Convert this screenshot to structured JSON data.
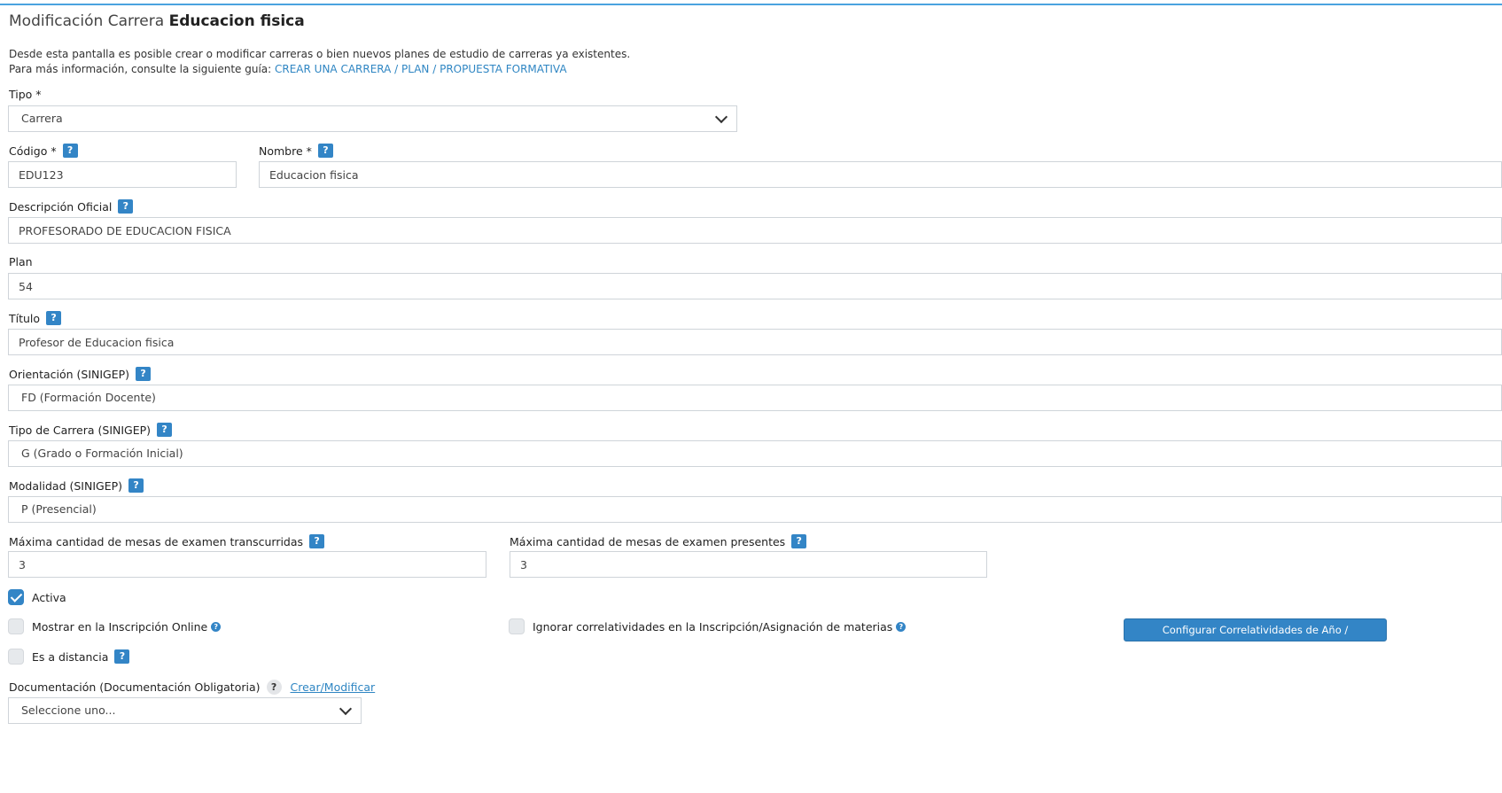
{
  "header": {
    "title_prefix": "Modificación Carrera",
    "title_name": "Educacion fisica"
  },
  "intro": {
    "line1": "Desde esta pantalla es posible crear o modificar carreras o bien nuevos planes de estudio de carreras ya existentes.",
    "line2_prefix": "Para más información, consulte la siguiente guía:",
    "guide_link": "CREAR UNA CARRERA / PLAN / PROPUESTA FORMATIVA"
  },
  "form": {
    "tipo": {
      "label": "Tipo *",
      "value": "Carrera"
    },
    "codigo": {
      "label": "Código *",
      "value": "EDU123"
    },
    "nombre": {
      "label": "Nombre *",
      "value": "Educacion fisica"
    },
    "descripcion": {
      "label": "Descripción Oficial",
      "value": "PROFESORADO DE EDUCACION FISICA"
    },
    "plan": {
      "label": "Plan",
      "value": "54"
    },
    "titulo": {
      "label": "Título",
      "value": "Profesor de Educacion fisica"
    },
    "orientacion": {
      "label": "Orientación (SINIGEP)",
      "value": "FD (Formación Docente)"
    },
    "tipo_carrera": {
      "label": "Tipo de Carrera (SINIGEP)",
      "value": "G (Grado o Formación Inicial)"
    },
    "modalidad": {
      "label": "Modalidad (SINIGEP)",
      "value": "P (Presencial)"
    },
    "max_transcurridas": {
      "label": "Máxima cantidad de mesas de examen transcurridas",
      "value": "3"
    },
    "max_presentes": {
      "label": "Máxima cantidad de mesas de examen presentes",
      "value": "3"
    },
    "activa": {
      "label": "Activa",
      "checked": true
    },
    "mostrar_online": {
      "label": "Mostrar en la Inscripción Online",
      "checked": false
    },
    "ignorar_correlatividades": {
      "label": "Ignorar correlatividades en la Inscripción/Asignación de materias",
      "checked": false
    },
    "a_distancia": {
      "label": "Es a distancia",
      "checked": false
    },
    "configurar_button": "Configurar Correlatividades de Año / Condicionalidad",
    "documentacion": {
      "label": "Documentación (Documentación Obligatoria)",
      "link": "Crear/Modificar",
      "value": "Seleccione uno..."
    }
  },
  "icons": {
    "help": "?",
    "accent": "#3385c6"
  }
}
